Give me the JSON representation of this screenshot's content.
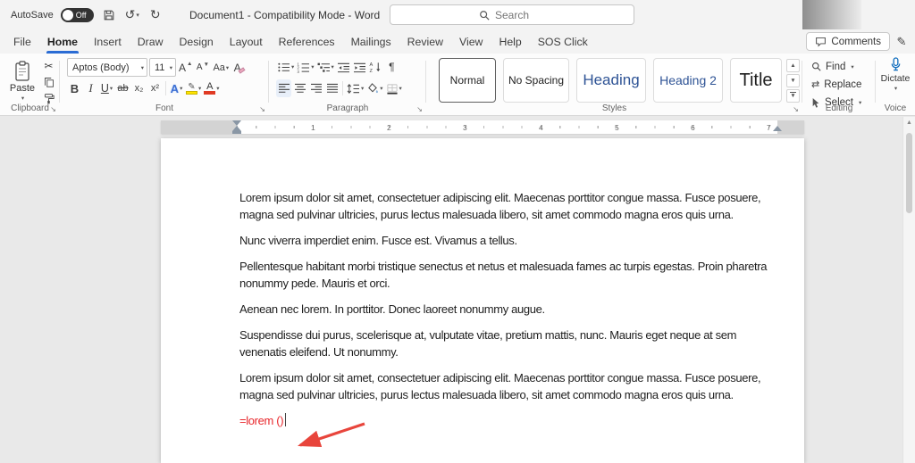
{
  "colors": {
    "accent_blue": "#2b6cd4",
    "heading_blue": "#2e5395",
    "field_red": "#e8262b",
    "arrow_red": "#e8453c",
    "highlight_yellow": "#ffe400",
    "font_color_red": "#e03b24",
    "dictate_blue": "#0f6cbd"
  },
  "icons": {
    "chevron": "▾",
    "up": "▲",
    "down": "▼",
    "undo": "↺",
    "redo": "↻",
    "pilcrow": "¶",
    "scissors": "✂",
    "pencil": "✎",
    "replace": "⇄",
    "launcher": "↘"
  },
  "titlebar": {
    "autosave_label": "AutoSave",
    "autosave_state": "Off",
    "title": "Document1 - Compatibility Mode - Word",
    "search_placeholder": "Search"
  },
  "menubar": {
    "tabs": [
      "File",
      "Home",
      "Insert",
      "Draw",
      "Design",
      "Layout",
      "References",
      "Mailings",
      "Review",
      "View",
      "Help",
      "SOS Click"
    ],
    "active_tab": "Home",
    "comments_label": "Comments"
  },
  "ribbon": {
    "clipboard": {
      "paste_label": "Paste",
      "group_label": "Clipboard"
    },
    "font": {
      "font_name": "Aptos (Body)",
      "font_size": "11",
      "buttons": {
        "grow": "A",
        "shrink": "A",
        "case": "Aa",
        "clear": "A",
        "bold": "B",
        "italic": "I",
        "underline": "U",
        "strike": "ab",
        "sub": "x₂",
        "sup": "x²",
        "effects": "A",
        "color": "A"
      },
      "group_label": "Font"
    },
    "paragraph": {
      "group_label": "Paragraph"
    },
    "styles": {
      "items": [
        "Normal",
        "No Spacing",
        "Heading",
        "Heading 2",
        "Title"
      ],
      "selected": "Normal",
      "group_label": "Styles"
    },
    "editing": {
      "find": "Find",
      "replace": "Replace",
      "select": "Select",
      "group_label": "Editing"
    },
    "voice": {
      "dictate_label": "Dictate",
      "group_label": "Voice"
    }
  },
  "ruler": {
    "numbers": [
      "1",
      "2",
      "3",
      "4",
      "5",
      "6",
      "7"
    ]
  },
  "document": {
    "paragraphs": [
      "Lorem ipsum dolor sit amet, consectetuer adipiscing elit. Maecenas porttitor congue massa. Fusce posuere, magna sed pulvinar ultricies, purus lectus malesuada libero, sit amet commodo magna eros quis urna.",
      "Nunc viverra imperdiet enim. Fusce est. Vivamus a tellus.",
      "Pellentesque habitant morbi tristique senectus et netus et malesuada fames ac turpis egestas. Proin pharetra nonummy pede. Mauris et orci.",
      "Aenean nec lorem. In porttitor. Donec laoreet nonummy augue.",
      "Suspendisse dui purus, scelerisque at, vulputate vitae, pretium mattis, nunc. Mauris eget neque at sem venenatis eleifend. Ut nonummy.",
      "Lorem ipsum dolor sit amet, consectetuer adipiscing elit. Maecenas porttitor congue massa. Fusce posuere, magna sed pulvinar ultricies, purus lectus malesuada libero, sit amet commodo magna eros quis urna."
    ],
    "field_code": "=lorem ()"
  }
}
